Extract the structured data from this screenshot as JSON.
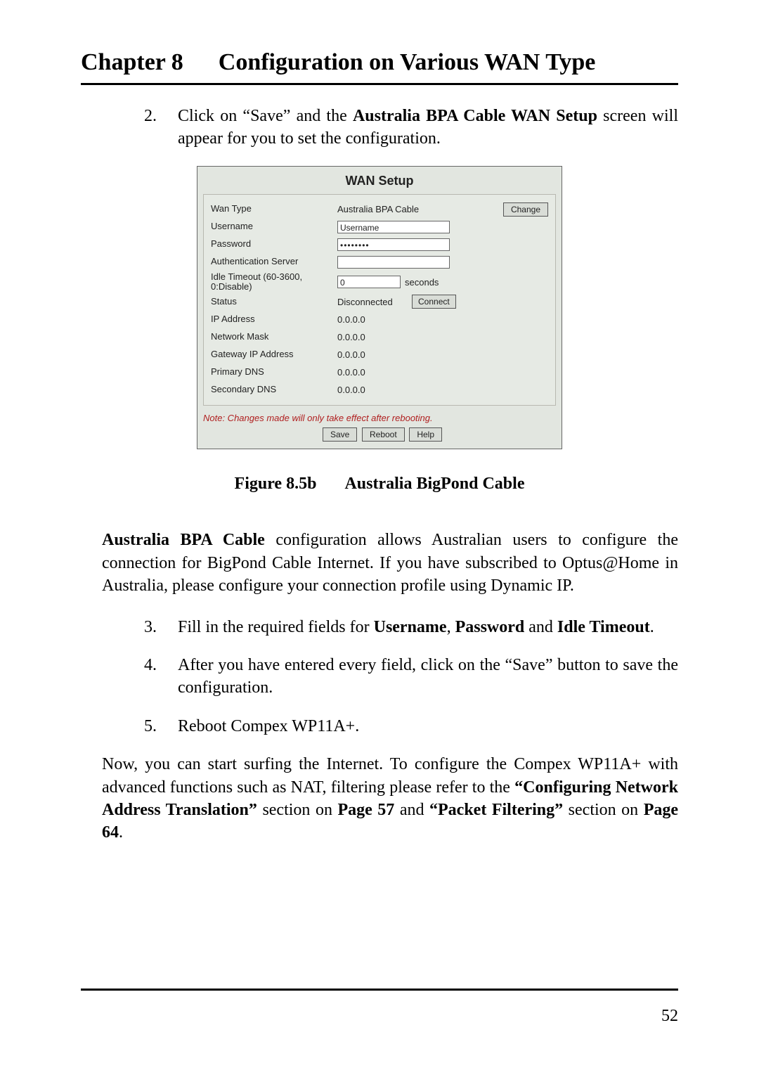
{
  "header": {
    "chapter": "Chapter 8",
    "title": "Configuration on Various WAN Type"
  },
  "step2": {
    "num": "2.",
    "pre": "Click on “Save” and the ",
    "bold": "Australia BPA Cable WAN Setup",
    "post": " screen will appear for you to set the configuration."
  },
  "wan": {
    "title": "WAN Setup",
    "rows": {
      "wan_type_label": "Wan Type",
      "wan_type_value": "Australia BPA Cable",
      "change_btn": "Change",
      "username_label": "Username",
      "username_value": "Username",
      "password_label": "Password",
      "password_value": "••••••••",
      "auth_label": "Authentication Server",
      "auth_value": "",
      "idle_label": "Idle Timeout (60-3600, 0:Disable)",
      "idle_value": "0",
      "idle_unit": "seconds",
      "status_label": "Status",
      "status_value": "Disconnected",
      "connect_btn": "Connect",
      "ip_label": "IP Address",
      "ip_value": "0.0.0.0",
      "mask_label": "Network Mask",
      "mask_value": "0.0.0.0",
      "gw_label": "Gateway IP Address",
      "gw_value": "0.0.0.0",
      "pdns_label": "Primary DNS",
      "pdns_value": "0.0.0.0",
      "sdns_label": "Secondary DNS",
      "sdns_value": "0.0.0.0"
    },
    "note": "Note: Changes made will only take effect after rebooting.",
    "buttons": {
      "save": "Save",
      "reboot": "Reboot",
      "help": "Help"
    }
  },
  "figure": {
    "label": "Figure 8.5b",
    "title": "Australia BigPond Cable"
  },
  "para_bpa": {
    "bold": "Australia BPA Cable",
    "rest": " configuration allows Australian users to configure the connection for BigPond Cable Internet. If you have subscribed to Optus@Home in Australia, please configure your connection profile using Dynamic IP."
  },
  "step3": {
    "num": "3.",
    "pre": "Fill in the required fields for ",
    "b1": "Username",
    "sep1": ", ",
    "b2": "Password",
    "sep2": " and ",
    "b3": "Idle Timeout",
    "post": "."
  },
  "step4": {
    "num": "4.",
    "text": "After you have entered every field, click on the “Save” button to save the configuration."
  },
  "step5": {
    "num": "5.",
    "text": "Reboot Compex WP11A+."
  },
  "closing": {
    "p1": "Now, you can start surfing the Internet. To configure the Compex WP11A+ with advanced functions such as NAT, filtering please refer to the ",
    "b1": "“Configuring Network Address Translation”",
    "p2": " section on ",
    "b2": "Page 57",
    "p3": " and ",
    "b3": "“Packet Filtering”",
    "p4": " section on ",
    "b4": "Page 64",
    "p5": "."
  },
  "page_number": "52"
}
